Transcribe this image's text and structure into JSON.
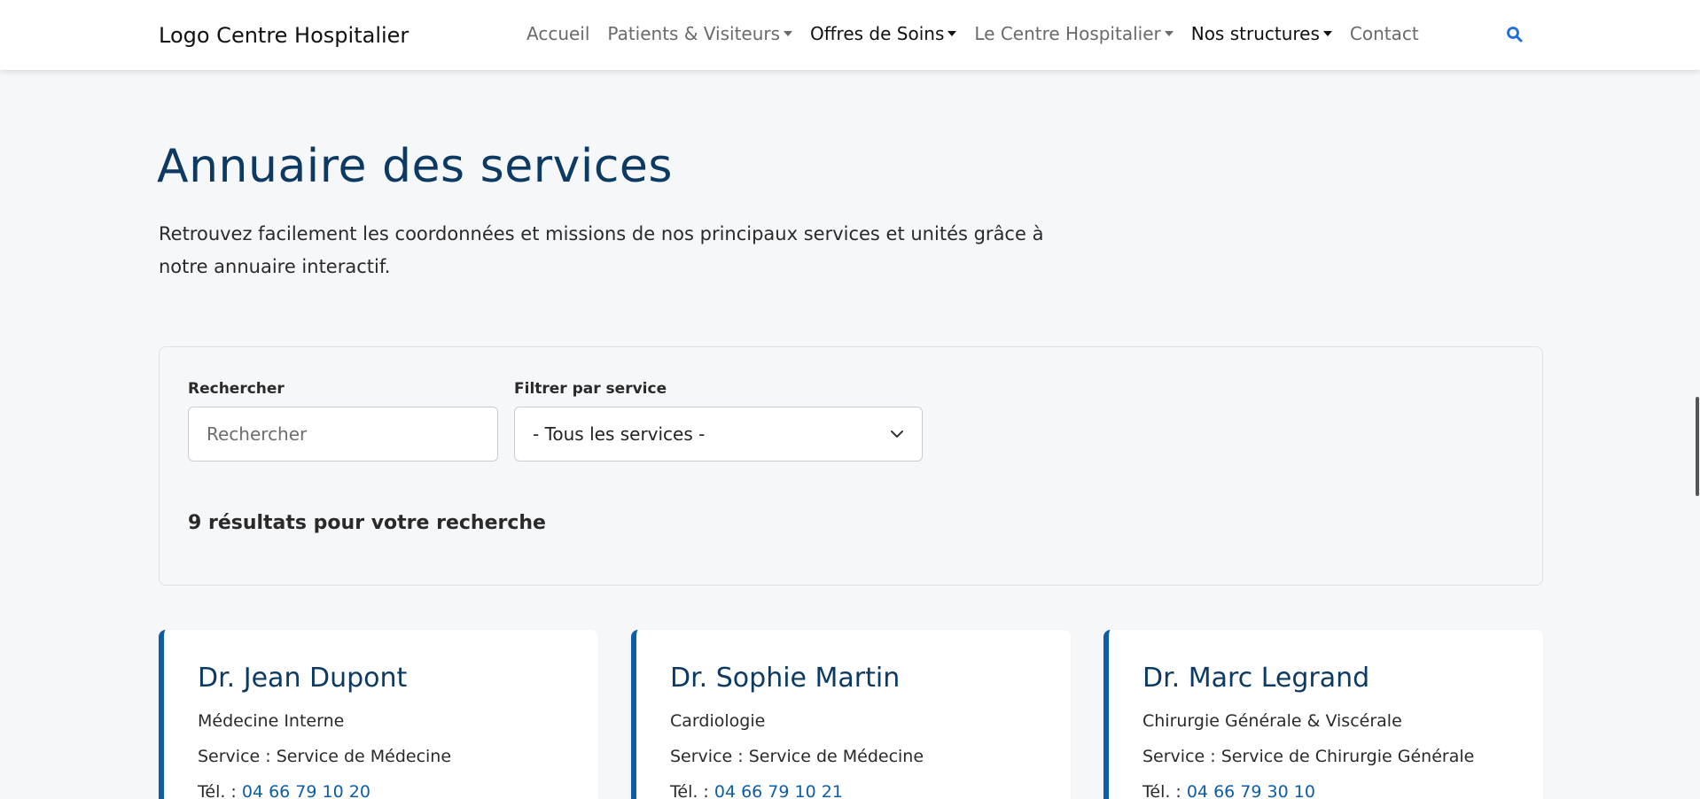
{
  "header": {
    "logo": "Logo Centre Hospitalier",
    "nav": [
      {
        "label": "Accueil",
        "dropdown": false,
        "dark": false
      },
      {
        "label": "Patients & Visiteurs",
        "dropdown": true,
        "dark": false
      },
      {
        "label": "Offres de Soins",
        "dropdown": true,
        "dark": true
      },
      {
        "label": "Le Centre Hospitalier",
        "dropdown": true,
        "dark": false
      },
      {
        "label": "Nos structures",
        "dropdown": true,
        "dark": true
      },
      {
        "label": "Contact",
        "dropdown": false,
        "dark": false
      }
    ],
    "search_icon": "search-icon"
  },
  "main": {
    "title": "Annuaire des services",
    "intro": "Retrouvez facilement les coordonnées et missions de nos principaux services et unités grâce à notre annuaire interactif."
  },
  "filters": {
    "search_label": "Rechercher",
    "search_placeholder": "Rechercher",
    "search_value": "",
    "service_label": "Filtrer par service",
    "service_selected": "- Tous les services -",
    "results": "9 résultats pour votre recherche"
  },
  "cards": [
    {
      "name": "Dr. Jean Dupont",
      "specialty": "Médecine Interne",
      "service": "Service : Service de Médecine",
      "phone_prefix": "Tél. :",
      "phone": "04 66 79 10 20"
    },
    {
      "name": "Dr. Sophie Martin",
      "specialty": "Cardiologie",
      "service": "Service : Service de Médecine",
      "phone_prefix": "Tél. :",
      "phone": "04 66 79 10 21"
    },
    {
      "name": "Dr. Marc Legrand",
      "specialty": "Chirurgie Générale & Viscérale",
      "service": "Service : Service de Chirurgie Générale",
      "phone_prefix": "Tél. :",
      "phone": "04 66 79 30 10"
    }
  ],
  "colors": {
    "primary": "#0d3a63",
    "accent": "#0d5ea6",
    "search_icon": "#1e6fd9",
    "background": "#f6f7f9"
  }
}
